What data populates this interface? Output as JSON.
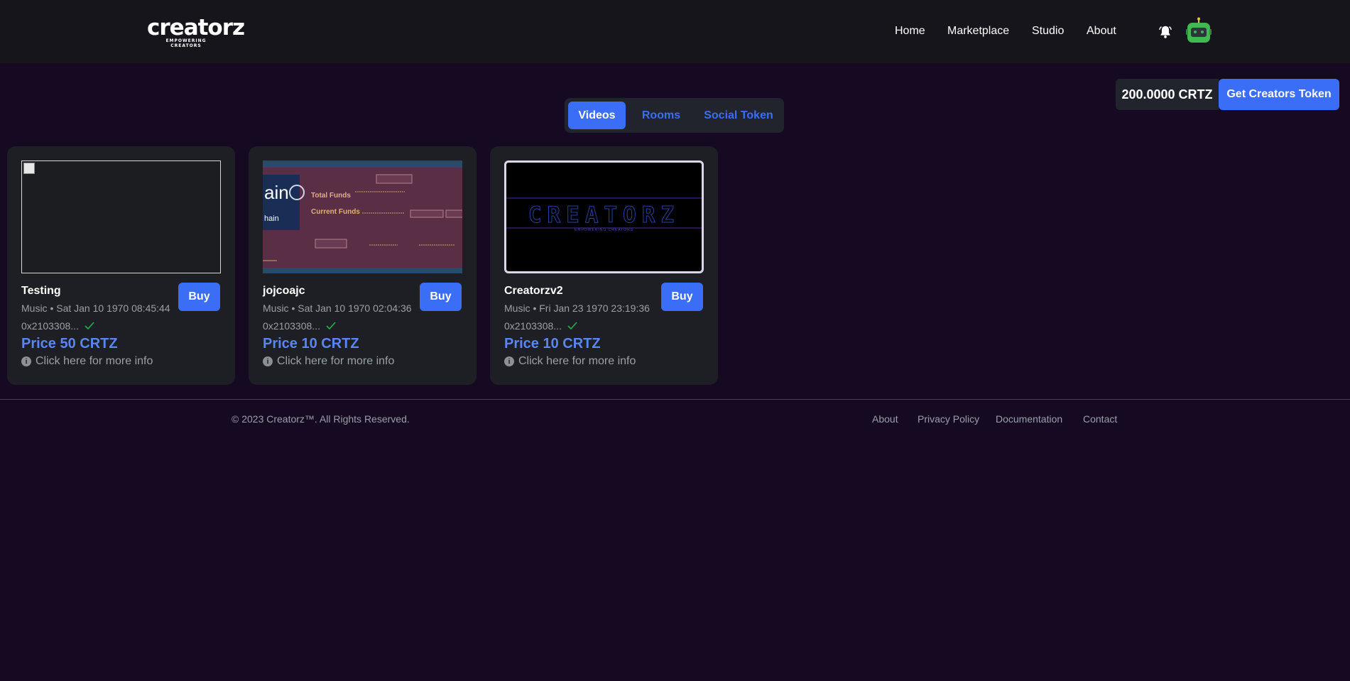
{
  "header": {
    "logo_text": "creatorz",
    "logo_tagline_line1": "EMPOWERING",
    "logo_tagline_line2": "CREATORS",
    "nav": [
      "Home",
      "Marketplace",
      "Studio",
      "About"
    ]
  },
  "wallet": {
    "balance": "200.0000 CRTZ",
    "get_token_label": "Get Creators Token"
  },
  "tabs": [
    {
      "label": "Videos",
      "active": true
    },
    {
      "label": "Rooms",
      "active": false
    },
    {
      "label": "Social Token",
      "active": false
    }
  ],
  "cards": [
    {
      "title": "Testing",
      "meta": "Music • Sat Jan 10 1970 08:45:44",
      "address": "0x2103308...",
      "price": "Price 50 CRTZ",
      "info": "Click here for more info",
      "buy_label": "Buy",
      "thumbnail": "broken-image"
    },
    {
      "title": "jojcoajc",
      "meta": "Music • Sat Jan 10 1970 02:04:36",
      "address": "0x2103308...",
      "price": "Price 10 CRTZ",
      "info": "Click here for more info",
      "buy_label": "Buy",
      "thumbnail": "screenshot-funds",
      "thumb_text": {
        "total_funds": "Total Funds",
        "current_funds": "Current Funds",
        "logo_fragment": "ain",
        "logo_fragment2": "hain"
      }
    },
    {
      "title": "Creatorzv2",
      "meta": "Music • Fri Jan 23 1970 23:19:36",
      "address": "0x2103308...",
      "price": "Price 10 CRTZ",
      "info": "Click here for more info",
      "buy_label": "Buy",
      "thumbnail": "creatorz-banner",
      "thumb_text": {
        "banner": "CREATORZ",
        "sub": "EMPOWERING CREATORS"
      }
    }
  ],
  "footer": {
    "copyright": "© 2023 Creatorz™. All Rights Reserved.",
    "links": [
      "About",
      "Privacy Policy",
      "Documentation",
      "Contact"
    ]
  },
  "colors": {
    "page_bg": "#160a22",
    "header_bg": "#17151c",
    "card_bg": "#1d1f24",
    "accent": "#3b6ef6",
    "price": "#5a86f5",
    "verified": "#22b14c"
  },
  "icons": [
    "bell-icon",
    "robot-avatar-icon",
    "check-icon",
    "info-icon"
  ]
}
